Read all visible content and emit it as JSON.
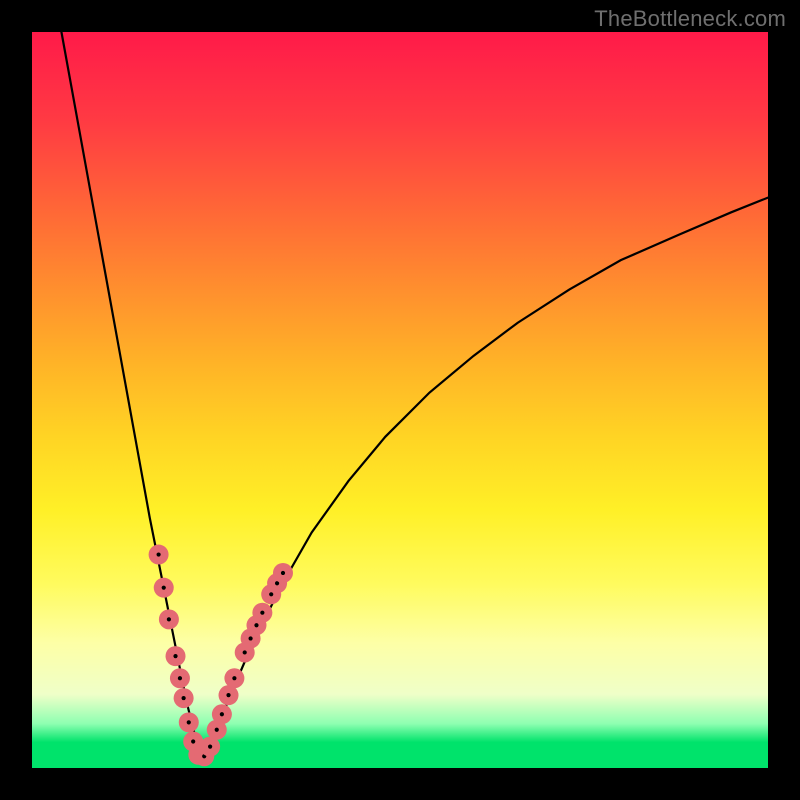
{
  "watermark": "TheBottleneck.com",
  "chart_data": {
    "type": "line",
    "title": "",
    "xlabel": "",
    "ylabel": "",
    "xlim": [
      0,
      100
    ],
    "ylim": [
      0,
      100
    ],
    "note": "Bottleneck-style V curve; pink markers cluster near the trough on both arms; background is a vertical rainbow gradient (red at top through yellow to green at bottom).",
    "series": [
      {
        "name": "left-arm",
        "x": [
          4,
          6,
          8,
          10,
          12,
          14,
          16,
          18,
          19,
          20,
          21,
          22,
          22.7
        ],
        "y": [
          100,
          89,
          78,
          67,
          56,
          45,
          34,
          24,
          19,
          14,
          9,
          5,
          1.5
        ]
      },
      {
        "name": "right-arm",
        "x": [
          23.3,
          25,
          27,
          30,
          34,
          38,
          43,
          48,
          54,
          60,
          66,
          73,
          80,
          88,
          95,
          100
        ],
        "y": [
          1.5,
          5,
          10,
          17,
          25,
          32,
          39,
          45,
          51,
          56,
          60.5,
          65,
          69,
          72.5,
          75.5,
          77.5
        ]
      }
    ],
    "trough_x": 23,
    "markers": {
      "color": "#e46a73",
      "radius": 10,
      "points": [
        {
          "x": 17.2,
          "y": 29
        },
        {
          "x": 17.9,
          "y": 24.5
        },
        {
          "x": 18.6,
          "y": 20.2
        },
        {
          "x": 19.5,
          "y": 15.2
        },
        {
          "x": 20.1,
          "y": 12.2
        },
        {
          "x": 20.6,
          "y": 9.5
        },
        {
          "x": 21.3,
          "y": 6.2
        },
        {
          "x": 21.9,
          "y": 3.6
        },
        {
          "x": 22.6,
          "y": 1.8
        },
        {
          "x": 23.4,
          "y": 1.6
        },
        {
          "x": 24.2,
          "y": 2.9
        },
        {
          "x": 25.1,
          "y": 5.2
        },
        {
          "x": 25.8,
          "y": 7.3
        },
        {
          "x": 26.7,
          "y": 9.9
        },
        {
          "x": 27.5,
          "y": 12.2
        },
        {
          "x": 28.9,
          "y": 15.7
        },
        {
          "x": 29.7,
          "y": 17.6
        },
        {
          "x": 30.5,
          "y": 19.4
        },
        {
          "x": 31.3,
          "y": 21.1
        },
        {
          "x": 32.5,
          "y": 23.6
        },
        {
          "x": 33.3,
          "y": 25.1
        },
        {
          "x": 34.1,
          "y": 26.5
        }
      ]
    }
  }
}
